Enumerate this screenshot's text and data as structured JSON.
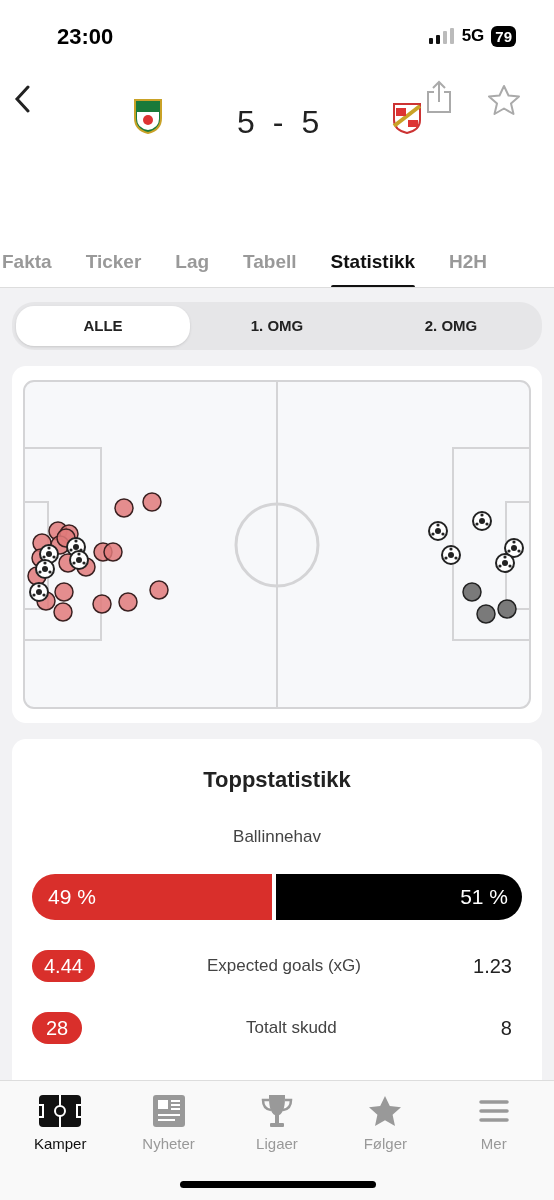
{
  "status_bar": {
    "time": "23:00",
    "network": "5G",
    "battery": "79"
  },
  "match": {
    "home_score": "5",
    "separator": "-",
    "away_score": "5"
  },
  "tabs": [
    {
      "label": "Fakta",
      "selected": false
    },
    {
      "label": "Ticker",
      "selected": false
    },
    {
      "label": "Lag",
      "selected": false
    },
    {
      "label": "Tabell",
      "selected": false
    },
    {
      "label": "Statistikk",
      "selected": true
    },
    {
      "label": "H2H",
      "selected": false
    }
  ],
  "periods": [
    {
      "label": "ALLE",
      "selected": true
    },
    {
      "label": "1. OMG",
      "selected": false
    },
    {
      "label": "2. OMG",
      "selected": false
    }
  ],
  "top_stats": {
    "title": "Toppstatistikk",
    "possession": {
      "label": "Ballinnehav",
      "home": "49 %",
      "away": "51 %",
      "level": 0.49
    },
    "rows": [
      {
        "home": "4.44",
        "label": "Expected goals (xG)",
        "away": "1.23"
      },
      {
        "home": "28",
        "label": "Totalt skudd",
        "away": "8"
      }
    ]
  },
  "nav": [
    {
      "label": "Kamper",
      "selected": true
    },
    {
      "label": "Nyheter",
      "selected": false
    },
    {
      "label": "Ligaer",
      "selected": false
    },
    {
      "label": "Følger",
      "selected": false
    },
    {
      "label": "Mer",
      "selected": false
    }
  ]
}
